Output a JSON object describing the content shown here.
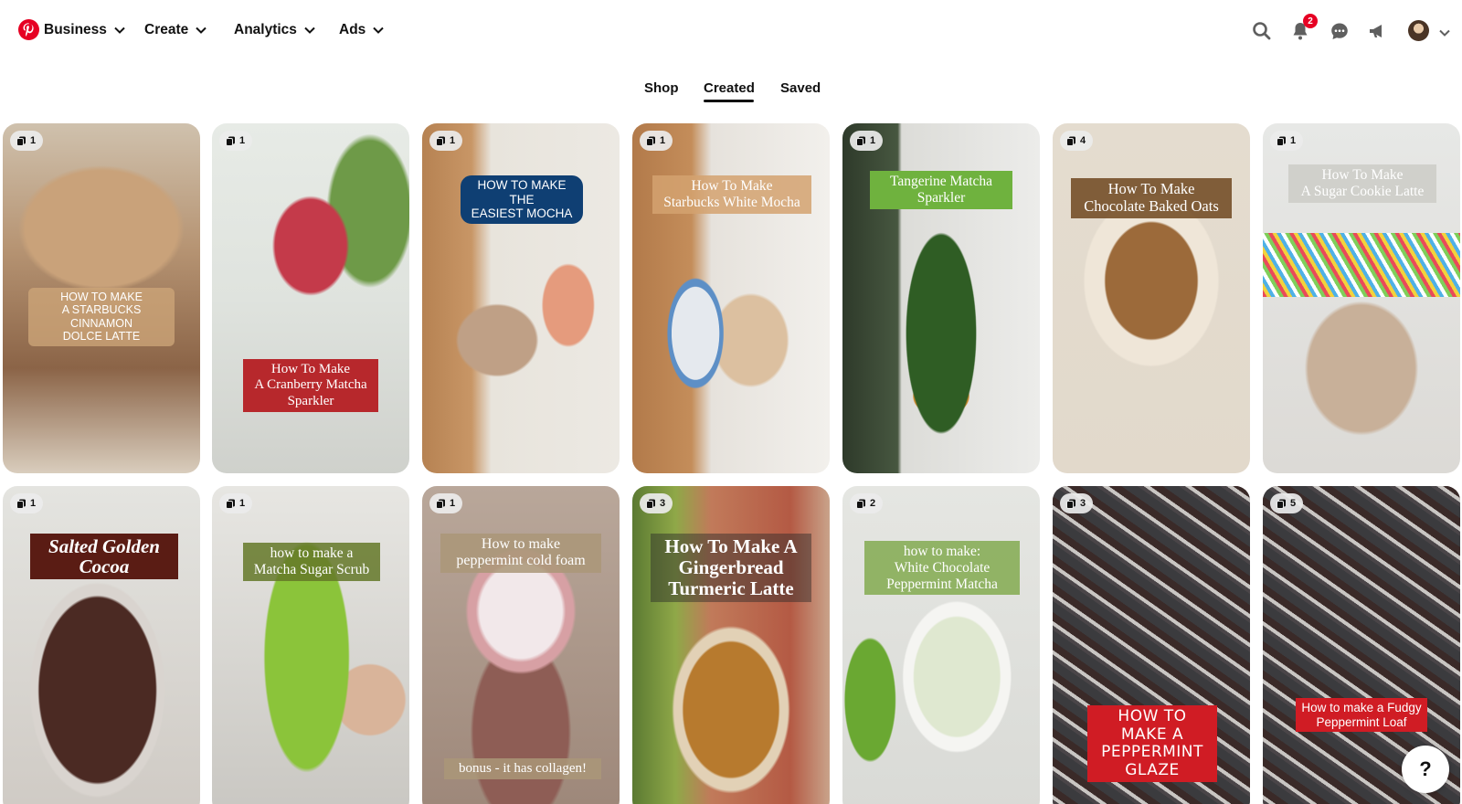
{
  "nav": {
    "logo": "pinterest-logo",
    "items": [
      {
        "label": "Business"
      },
      {
        "label": "Create"
      },
      {
        "label": "Analytics"
      },
      {
        "label": "Ads"
      }
    ],
    "notifications_badge": "2",
    "icons": [
      "search-icon",
      "notifications-icon",
      "messages-icon",
      "megaphone-icon",
      "account-avatar",
      "chevron-down-icon"
    ]
  },
  "tabs": {
    "items": [
      {
        "label": "Shop"
      },
      {
        "label": "Created"
      },
      {
        "label": "Saved"
      }
    ],
    "active": "Created"
  },
  "pins": [
    {
      "count": "1",
      "title": "HOW TO MAKE\nA STARBUCKS CINNAMON\nDOLCE LATTE"
    },
    {
      "count": "1",
      "title": "How To Make\nA Cranberry Matcha\nSparkler"
    },
    {
      "count": "1",
      "title": "HOW TO MAKE THE\nEASIEST MOCHA"
    },
    {
      "count": "1",
      "title": "How To Make\nStarbucks White Mocha"
    },
    {
      "count": "1",
      "title": "Tangerine Matcha\nSparkler"
    },
    {
      "count": "4",
      "title": "How To Make\nChocolate Baked Oats"
    },
    {
      "count": "1",
      "title": "How To Make\nA Sugar Cookie Latte"
    },
    {
      "count": "1",
      "title": "Salted Golden\nCocoa"
    },
    {
      "count": "1",
      "title": "how to make a\nMatcha Sugar Scrub"
    },
    {
      "count": "1",
      "title": "How to make\npeppermint cold foam",
      "subtitle": "bonus - it has collagen!"
    },
    {
      "count": "3",
      "title": "How To Make A\nGingerbread\nTurmeric Latte"
    },
    {
      "count": "2",
      "title": "how to make:\nWhite Chocolate\nPeppermint Matcha"
    },
    {
      "count": "3",
      "title": "HOW TO MAKE A\nPEPPERMINT GLAZE"
    },
    {
      "count": "5",
      "title": "How to make a Fudgy\nPeppermint Loaf"
    }
  ],
  "help": {
    "label": "?"
  },
  "colors": {
    "brand": "#e60023",
    "text": "#111111",
    "chip_bg": "#ebebeb"
  }
}
